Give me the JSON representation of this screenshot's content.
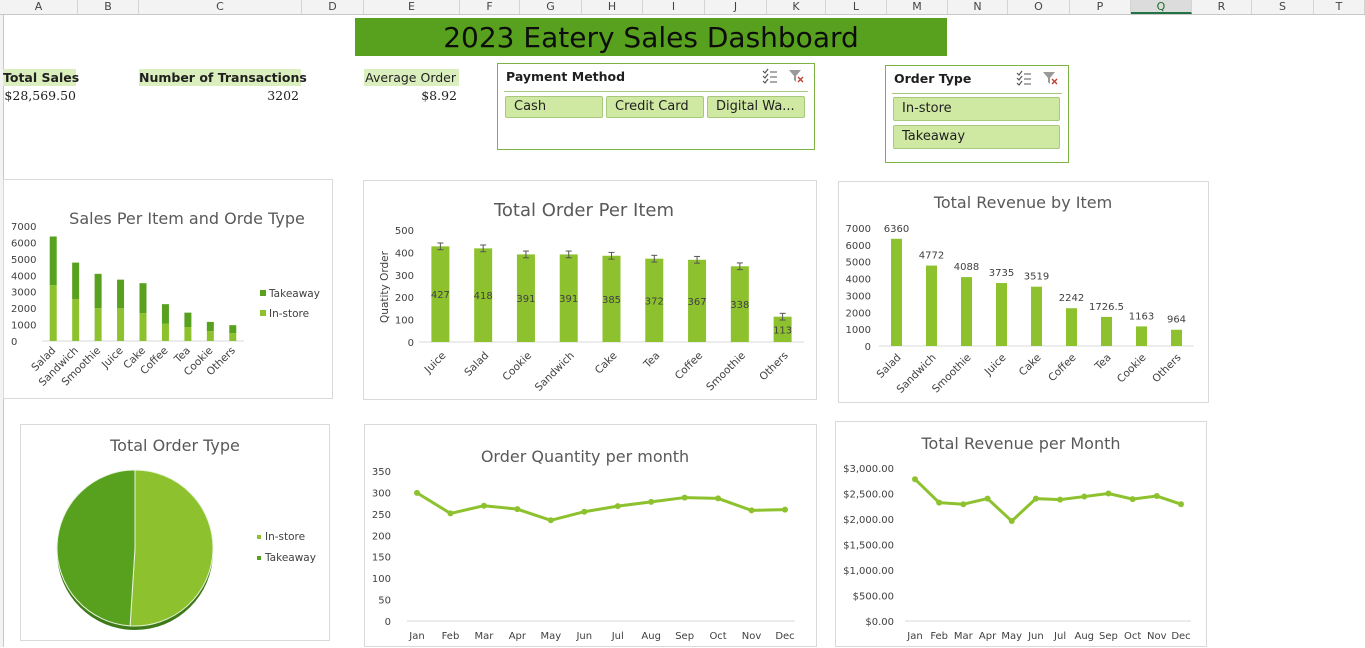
{
  "sheet": {
    "columns": [
      "A",
      "B",
      "C",
      "D",
      "E",
      "F",
      "G",
      "H",
      "I",
      "J",
      "K",
      "L",
      "M",
      "N",
      "O",
      "P",
      "Q",
      "R",
      "S",
      "T"
    ],
    "active_column": "Q"
  },
  "dashboard": {
    "title": "2023 Eatery Sales Dashboard"
  },
  "kpis": {
    "total_sales_label": "Total Sales",
    "total_sales_value": "$28,569.50",
    "transactions_label": "Number of Transactions",
    "transactions_value": "3202",
    "avg_order_label": "Average Order",
    "avg_order_value": "$8.92"
  },
  "slicers": {
    "payment": {
      "title": "Payment Method",
      "options": [
        "Cash",
        "Credit Card",
        "Digital Wa..."
      ]
    },
    "order_type": {
      "title": "Order Type",
      "options": [
        "In-store",
        "Takeaway"
      ]
    }
  },
  "colors": {
    "dark_green": "#57a11f",
    "light_green": "#8dc22e",
    "kpi_fill": "#dbeebd"
  },
  "charts": {
    "sales_per_item": {
      "title": "Sales Per Item and Orde Type",
      "categories": [
        "Salad",
        "Sandwich",
        "Smoothie",
        "Juice",
        "Cake",
        "Coffee",
        "Tea",
        "Cookie",
        "Others"
      ],
      "series": [
        {
          "name": "In-store",
          "values": [
            3400,
            2550,
            2000,
            2000,
            1700,
            1050,
            850,
            600,
            480
          ]
        },
        {
          "name": "Takeaway",
          "values": [
            2960,
            2222,
            2088,
            1735,
            1819,
            1192,
            877,
            563,
            484
          ]
        }
      ],
      "ylim": [
        0,
        7000
      ],
      "yticks": [
        "0",
        "1000",
        "2000",
        "3000",
        "4000",
        "5000",
        "6000",
        "7000"
      ],
      "legend": [
        "Takeaway",
        "In-store"
      ]
    },
    "total_order_per_item": {
      "title": "Total Order Per Item",
      "ylabel": "Quatity Order",
      "categories": [
        "Juice",
        "Salad",
        "Cookie",
        "Sandwich",
        "Cake",
        "Tea",
        "Coffee",
        "Smoothie",
        "Others"
      ],
      "values": [
        427,
        418,
        391,
        391,
        385,
        372,
        367,
        338,
        113
      ],
      "value_labels": [
        "427",
        "418",
        "391",
        "391",
        "385",
        "372",
        "367",
        "338",
        "113"
      ],
      "ylim": [
        0,
        500
      ],
      "yticks": [
        "0",
        "100",
        "200",
        "300",
        "400",
        "500"
      ]
    },
    "total_revenue_by_item": {
      "title": "Total Revenue by Item",
      "categories": [
        "Salad",
        "Sandwich",
        "Smoothie",
        "Juice",
        "Cake",
        "Coffee",
        "Tea",
        "Cookie",
        "Others"
      ],
      "values": [
        6360,
        4772,
        4088,
        3735,
        3519,
        2242,
        1726.5,
        1163,
        964
      ],
      "value_labels": [
        "6360",
        "4772",
        "4088",
        "3735",
        "3519",
        "2242",
        "1726.5",
        "1163",
        "964"
      ],
      "ylim": [
        0,
        7000
      ],
      "yticks": [
        "0",
        "1000",
        "2000",
        "3000",
        "4000",
        "5000",
        "6000",
        "7000"
      ]
    },
    "total_order_type": {
      "title": "Total Order Type",
      "slices": [
        {
          "name": "In-store",
          "value": 51
        },
        {
          "name": "Takeaway",
          "value": 49
        }
      ],
      "legend": [
        "In-store",
        "Takeaway"
      ]
    },
    "order_qty_per_month": {
      "title": "Order Quantity per month",
      "categories": [
        "Jan",
        "Feb",
        "Mar",
        "Apr",
        "May",
        "Jun",
        "Jul",
        "Aug",
        "Sep",
        "Oct",
        "Nov",
        "Dec"
      ],
      "values": [
        299,
        251,
        269,
        261,
        235,
        255,
        268,
        278,
        288,
        286,
        258,
        260
      ],
      "ylim": [
        0,
        350
      ],
      "yticks": [
        "0",
        "50",
        "100",
        "150",
        "200",
        "250",
        "300",
        "350"
      ]
    },
    "revenue_per_month": {
      "title": "Total Revenue per Month",
      "categories": [
        "Jan",
        "Feb",
        "Mar",
        "Apr",
        "May",
        "Jun",
        "Jul",
        "Aug",
        "Sep",
        "Oct",
        "Nov",
        "Dec"
      ],
      "values": [
        2780,
        2320,
        2290,
        2400,
        1960,
        2400,
        2380,
        2440,
        2500,
        2390,
        2450,
        2290
      ],
      "ylim": [
        0,
        3000
      ],
      "yticks": [
        "$0.00",
        "$500.00",
        "$1,000.00",
        "$1,500.00",
        "$2,000.00",
        "$2,500.00",
        "$3,000.00"
      ]
    }
  },
  "chart_data": [
    {
      "type": "bar",
      "title": "Sales Per Item and Orde Type",
      "categories": [
        "Salad",
        "Sandwich",
        "Smoothie",
        "Juice",
        "Cake",
        "Coffee",
        "Tea",
        "Cookie",
        "Others"
      ],
      "series": [
        {
          "name": "In-store",
          "values": [
            3400,
            2550,
            2000,
            2000,
            1700,
            1050,
            850,
            600,
            480
          ]
        },
        {
          "name": "Takeaway",
          "values": [
            2960,
            2222,
            2088,
            1735,
            1819,
            1192,
            877,
            563,
            484
          ]
        }
      ],
      "ylim": [
        0,
        7000
      ]
    },
    {
      "type": "bar",
      "title": "Total Order Per Item",
      "ylabel": "Quatity Order",
      "categories": [
        "Juice",
        "Salad",
        "Cookie",
        "Sandwich",
        "Cake",
        "Tea",
        "Coffee",
        "Smoothie",
        "Others"
      ],
      "values": [
        427,
        418,
        391,
        391,
        385,
        372,
        367,
        338,
        113
      ],
      "ylim": [
        0,
        500
      ]
    },
    {
      "type": "bar",
      "title": "Total Revenue by Item",
      "categories": [
        "Salad",
        "Sandwich",
        "Smoothie",
        "Juice",
        "Cake",
        "Coffee",
        "Tea",
        "Cookie",
        "Others"
      ],
      "values": [
        6360,
        4772,
        4088,
        3735,
        3519,
        2242,
        1726.5,
        1163,
        964
      ],
      "ylim": [
        0,
        7000
      ]
    },
    {
      "type": "pie",
      "title": "Total Order Type",
      "categories": [
        "In-store",
        "Takeaway"
      ],
      "values": [
        51,
        49
      ]
    },
    {
      "type": "line",
      "title": "Order Quantity per month",
      "categories": [
        "Jan",
        "Feb",
        "Mar",
        "Apr",
        "May",
        "Jun",
        "Jul",
        "Aug",
        "Sep",
        "Oct",
        "Nov",
        "Dec"
      ],
      "values": [
        299,
        251,
        269,
        261,
        235,
        255,
        268,
        278,
        288,
        286,
        258,
        260
      ],
      "ylim": [
        0,
        350
      ]
    },
    {
      "type": "line",
      "title": "Total Revenue per Month",
      "categories": [
        "Jan",
        "Feb",
        "Mar",
        "Apr",
        "May",
        "Jun",
        "Jul",
        "Aug",
        "Sep",
        "Oct",
        "Nov",
        "Dec"
      ],
      "values": [
        2780,
        2320,
        2290,
        2400,
        1960,
        2400,
        2380,
        2440,
        2500,
        2390,
        2450,
        2290
      ],
      "ylim": [
        0,
        3000
      ]
    }
  ]
}
